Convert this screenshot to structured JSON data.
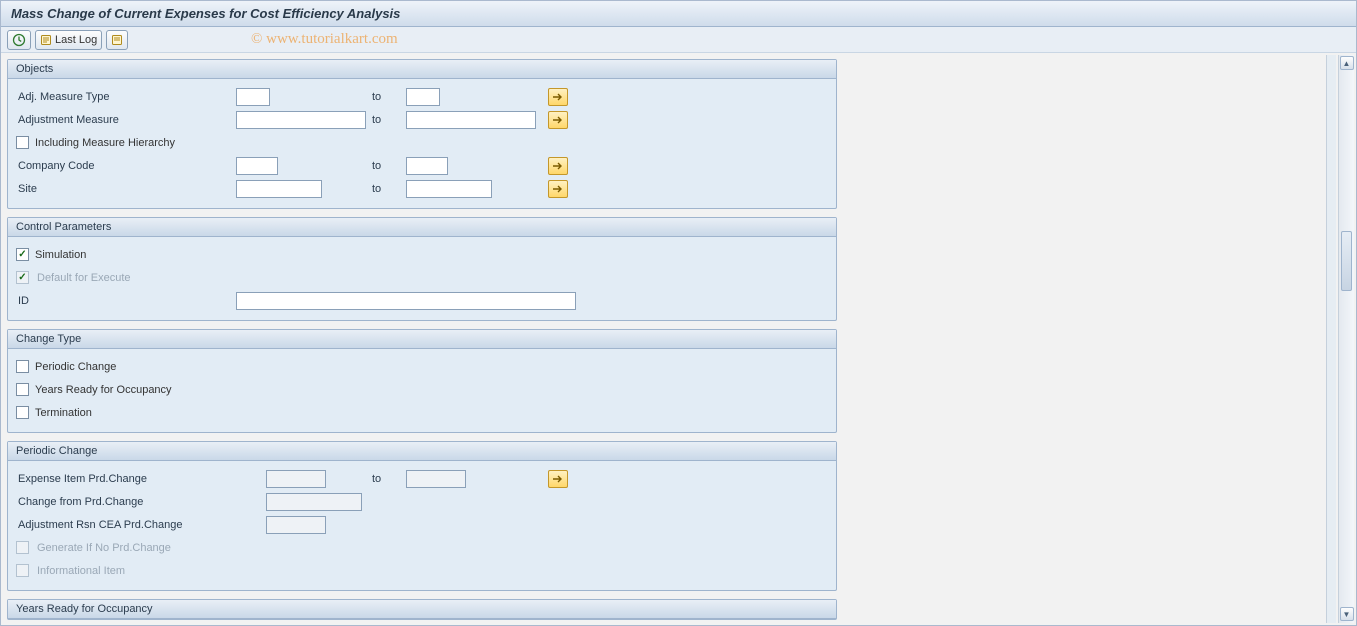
{
  "title": "Mass Change of Current Expenses for Cost Efficiency Analysis",
  "toolbar": {
    "execute_tip": "Execute",
    "last_log_label": "Last Log",
    "variant_tip": "Get Variant"
  },
  "watermark": "© www.tutorialkart.com",
  "groups": {
    "objects": {
      "title": "Objects",
      "adj_measure_type_label": "Adj. Measure Type",
      "adjustment_measure_label": "Adjustment Measure",
      "including_hierarchy_label": "Including Measure Hierarchy",
      "company_code_label": "Company Code",
      "site_label": "Site",
      "to_label": "to"
    },
    "control": {
      "title": "Control Parameters",
      "simulation_label": "Simulation",
      "simulation_checked": true,
      "default_exec_label": "Default for Execute",
      "default_exec_checked": true,
      "id_label": "ID"
    },
    "change_type": {
      "title": "Change Type",
      "periodic_change_label": "Periodic Change",
      "years_ready_label": "Years Ready for Occupancy",
      "termination_label": "Termination"
    },
    "periodic": {
      "title": "Periodic Change",
      "expense_item_label": "Expense Item Prd.Change",
      "change_from_label": "Change from Prd.Change",
      "adj_rsn_label": "Adjustment Rsn CEA Prd.Change",
      "generate_if_no_label": "Generate If No Prd.Change",
      "informational_item_label": "Informational Item",
      "to_label": "to"
    },
    "years_ready": {
      "title": "Years Ready for Occupancy"
    }
  }
}
